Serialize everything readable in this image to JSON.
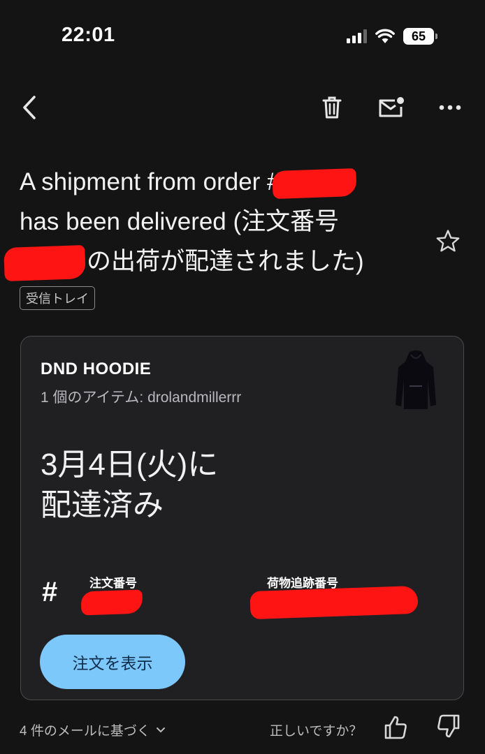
{
  "status_bar": {
    "time": "22:01",
    "battery": "65",
    "icons": [
      "signal-icon",
      "wifi-icon",
      "battery-icon"
    ]
  },
  "toolbar": {
    "icons": [
      "back-arrow-icon",
      "trash-icon",
      "mark-unread-icon",
      "more-options-icon"
    ]
  },
  "email": {
    "subject_line1": "A shipment from order #",
    "subject_line2": "has been delivered (注文番号",
    "subject_line3": "の出荷が配達されました)",
    "label": "受信トレイ",
    "star_icon": "star-outline-icon"
  },
  "card": {
    "product_name": "DND HOODIE",
    "item_line": "1 個のアイテム: drolandmillerrr",
    "delivery_line1": "3月4日(火)に",
    "delivery_line2": "配達済み",
    "hash_symbol": "#",
    "order_number_label": "注文番号",
    "tracking_number_label": "荷物追跡番号",
    "view_order_button": "注文を表示",
    "colors": {
      "button_bg": "#7dc8fb",
      "card_bg": "#202023",
      "redaction": "#ff1414"
    }
  },
  "footer": {
    "based_on": "4 件のメールに基づく",
    "is_correct": "正しいですか？",
    "icons": [
      "chevron-down-icon",
      "thumbs-up-icon",
      "thumbs-down-icon"
    ]
  }
}
